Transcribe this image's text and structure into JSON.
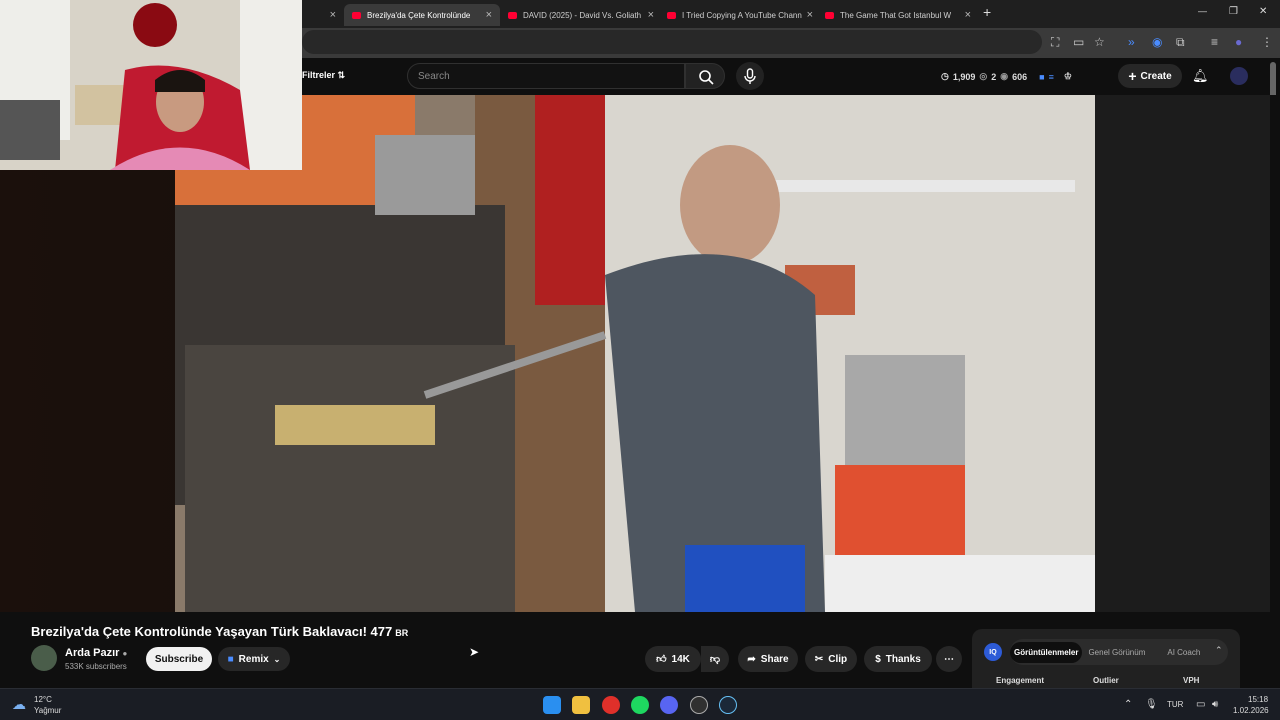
{
  "browser": {
    "tabs": [
      {
        "label": "Brezilya'da Çete Kontrolünde",
        "active": true
      },
      {
        "label": "DAVID (2025) - David Vs. Goliath"
      },
      {
        "label": "I Tried Copying A YouTube Chann"
      },
      {
        "label": "The Game That Got Istanbul W"
      }
    ],
    "new_tab": "+",
    "win_minimize": "—",
    "win_restore": "❐",
    "win_close": "✕"
  },
  "youtube": {
    "filters_label": "Filtreler",
    "search_placeholder": "Search",
    "stats": {
      "views": "1,909",
      "eye": "2",
      "watch": "606"
    },
    "create_label": "Create"
  },
  "video": {
    "title": "Brezilya'da Çete Kontrolünde Yaşayan Türk Baklavacı! 477",
    "title_badge": "BR",
    "channel_name": "Arda Pazır",
    "subscribers": "533K subscribers",
    "subscribe_label": "Subscribe",
    "remix_label": "Remix",
    "likes": "14K",
    "share_label": "Share",
    "clip_label": "Clip",
    "thanks_label": "Thanks"
  },
  "extension": {
    "badge": "IQ",
    "tabs": [
      "Görüntülenmeler",
      "Genel Görünüm",
      "AI Coach"
    ],
    "columns": [
      "Engagement",
      "Outlier",
      "VPH"
    ]
  },
  "taskbar": {
    "weather_temp": "12°C",
    "weather_desc": "Yağmur",
    "lang": "TUR",
    "time": "15:18",
    "date": "1.02.2026"
  },
  "colors": {
    "yt_red": "#ff0033",
    "bg": "#0f0f0f"
  }
}
